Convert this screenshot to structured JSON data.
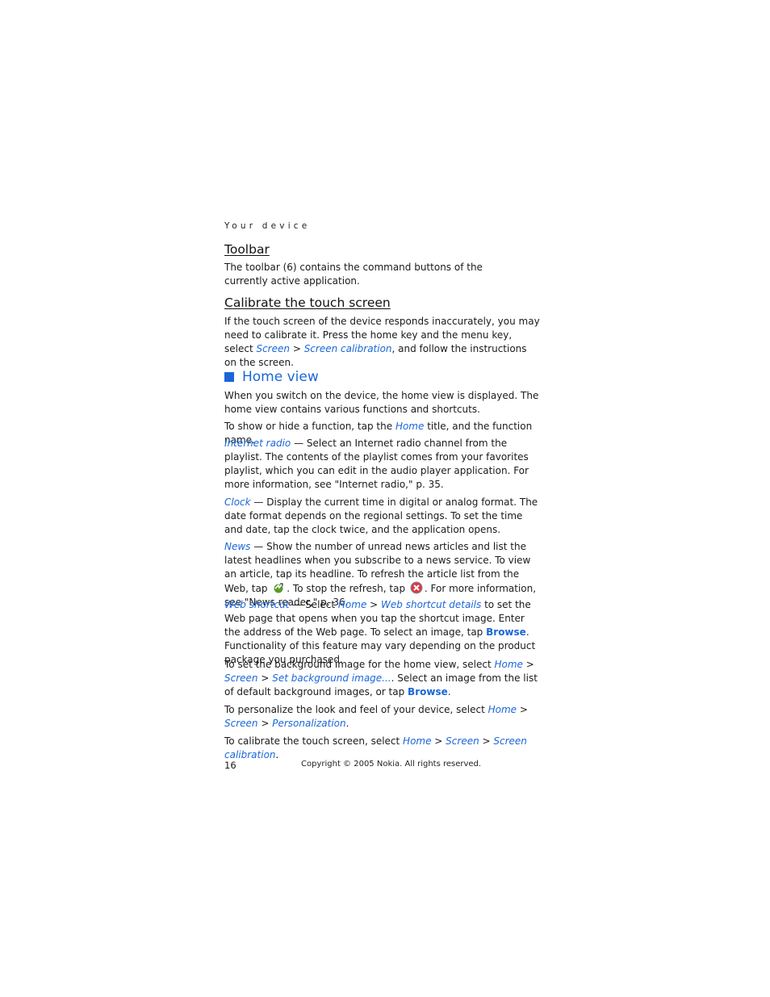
{
  "running_head": "Your device",
  "toolbar": {
    "title": "Toolbar",
    "text": "The toolbar (6) contains the command buttons of the currently active application."
  },
  "calibrate": {
    "title": "Calibrate the touch screen",
    "text_1": "If the touch screen of the device responds inaccurately, you may need to calibrate it. Press the home key and the menu key, select ",
    "menu_screen": "Screen",
    "sep": " > ",
    "menu_calibration": "Screen calibration",
    "text_2": ", and follow the instructions on the screen."
  },
  "home_view": {
    "title": "Home view",
    "intro": "When you switch on the device, the home view is displayed. The home view contains various functions and shortcuts.",
    "show_hide_1": "To show or hide a function, tap the ",
    "home": "Home",
    "show_hide_2": " title, and the function name.",
    "internet_radio": "Internet radio",
    "internet_radio_text": " — Select an Internet radio channel from the playlist. The contents of the playlist comes from your favorites playlist, which you can edit in the audio player application. For more information, see \"Internet radio,\" p. 35.",
    "clock": "Clock",
    "clock_text": " — Display the current time in digital or analog format. The date format depends on the regional settings. To set the time and date, tap the clock twice, and the application opens.",
    "news": "News",
    "news_text_1": " — Show the number of unread news articles and list the latest headlines when you subscribe to a news service. To view an article, tap its headline. To refresh the article list from the Web, tap ",
    "news_text_2": ". To stop the refresh, tap ",
    "news_text_3": ". For more information, see \"News reader,\" p. 36.",
    "web_shortcut": "Web shortcut",
    "web_text_1": " — Select ",
    "web_shortcut_details": "Web shortcut details",
    "web_text_2": " to set the Web page that opens when you tap the shortcut image. Enter the address of the Web page. To select an image, tap ",
    "browse": "Browse",
    "web_text_3": ". Functionality of this feature may vary depending on the product package you purchased.",
    "bg_text_1": "To set the background image for the home view, select ",
    "screen": "Screen",
    "set_bg": "Set background image...",
    "bg_text_2": ". Select an image from the list of default background images, or tap ",
    "period": ".",
    "pers_text_1": "To personalize the look and feel of your device, select ",
    "personalization": "Personalization",
    "cal_text_1": "To calibrate the touch screen, select ",
    "screen_calibration": "Screen calibration",
    "gt": " > "
  },
  "icons": {
    "refresh": "refresh-icon",
    "stop": "stop-icon"
  },
  "colors": {
    "accent": "#1a66d9"
  },
  "footer": {
    "page_number": "16",
    "copyright": "Copyright © 2005 Nokia. All rights reserved."
  }
}
